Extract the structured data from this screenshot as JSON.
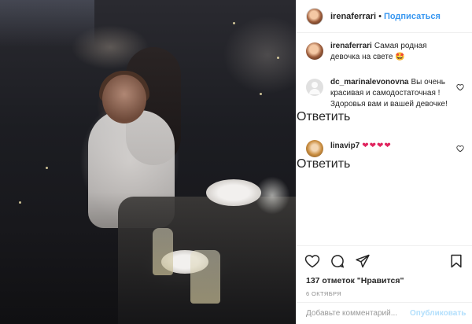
{
  "post": {
    "photo_alt": "photo",
    "username": "irenaferrari",
    "follow_label": "Подписаться",
    "separator": "•"
  },
  "caption": {
    "username": "irenaferrari",
    "text": "Самая родная девочка на свете 🤩"
  },
  "comments": [
    {
      "username": "dc_marinalevonovna",
      "text": "Вы очень красивая и самодостаточная ! Здоровья вам и вашей девочке!",
      "reply_label": "Ответить",
      "avatar_icon": "default-avatar-icon",
      "like_icon": "heart-outline-icon"
    },
    {
      "username": "linavip7",
      "text": "❤❤❤❤",
      "reply_label": "Ответить",
      "avatar_icon": "user-avatar-icon",
      "like_icon": "heart-outline-icon"
    }
  ],
  "actions": {
    "like_icon": "heart-outline-icon",
    "comment_icon": "comment-bubble-icon",
    "share_icon": "share-arrow-icon",
    "save_icon": "bookmark-icon",
    "likes_text": "137 отметок \"Нравится\"",
    "date": "6 октября"
  },
  "add_comment": {
    "placeholder": "Добавьте комментарий...",
    "publish_label": "Опубликовать"
  },
  "colors": {
    "link_blue": "#3897f0",
    "publish_disabled": "#b2dffc",
    "muted_text": "#8e8e8e",
    "heart_red": "#e0245e"
  }
}
